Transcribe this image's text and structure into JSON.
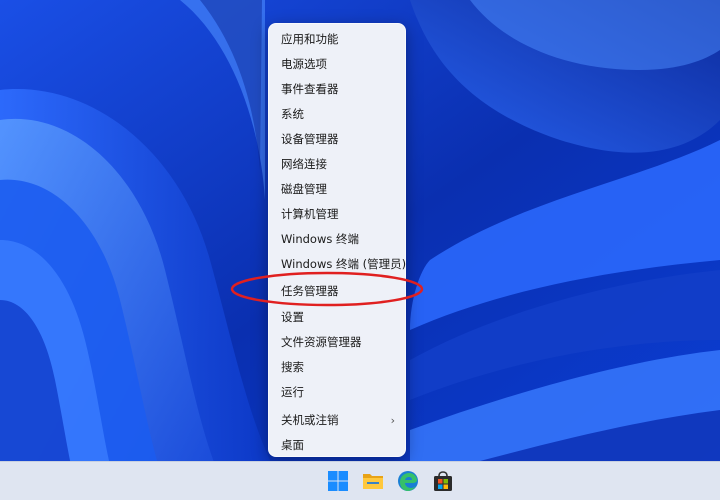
{
  "menu": {
    "items": [
      {
        "label": "应用和功能"
      },
      {
        "label": "电源选项"
      },
      {
        "label": "事件查看器"
      },
      {
        "label": "系统"
      },
      {
        "label": "设备管理器"
      },
      {
        "label": "网络连接"
      },
      {
        "label": "磁盘管理"
      },
      {
        "label": "计算机管理"
      },
      {
        "label": "Windows 终端"
      },
      {
        "label": "Windows 终端 (管理员)"
      },
      {
        "label": "任务管理器"
      },
      {
        "label": "设置"
      },
      {
        "label": "文件资源管理器"
      },
      {
        "label": "搜索"
      },
      {
        "label": "运行"
      },
      {
        "label": "关机或注销"
      },
      {
        "label": "桌面"
      }
    ],
    "submenu_chevron": "›"
  },
  "taskbar": {
    "icons": [
      "windows-start-icon",
      "file-explorer-icon",
      "edge-browser-icon",
      "microsoft-store-icon"
    ]
  },
  "colors": {
    "wallpaper_base": "#0a2fb0",
    "annotation": "#e02020",
    "menu_bg": "#eef1f8",
    "taskbar_bg": "#dfe5f1"
  }
}
